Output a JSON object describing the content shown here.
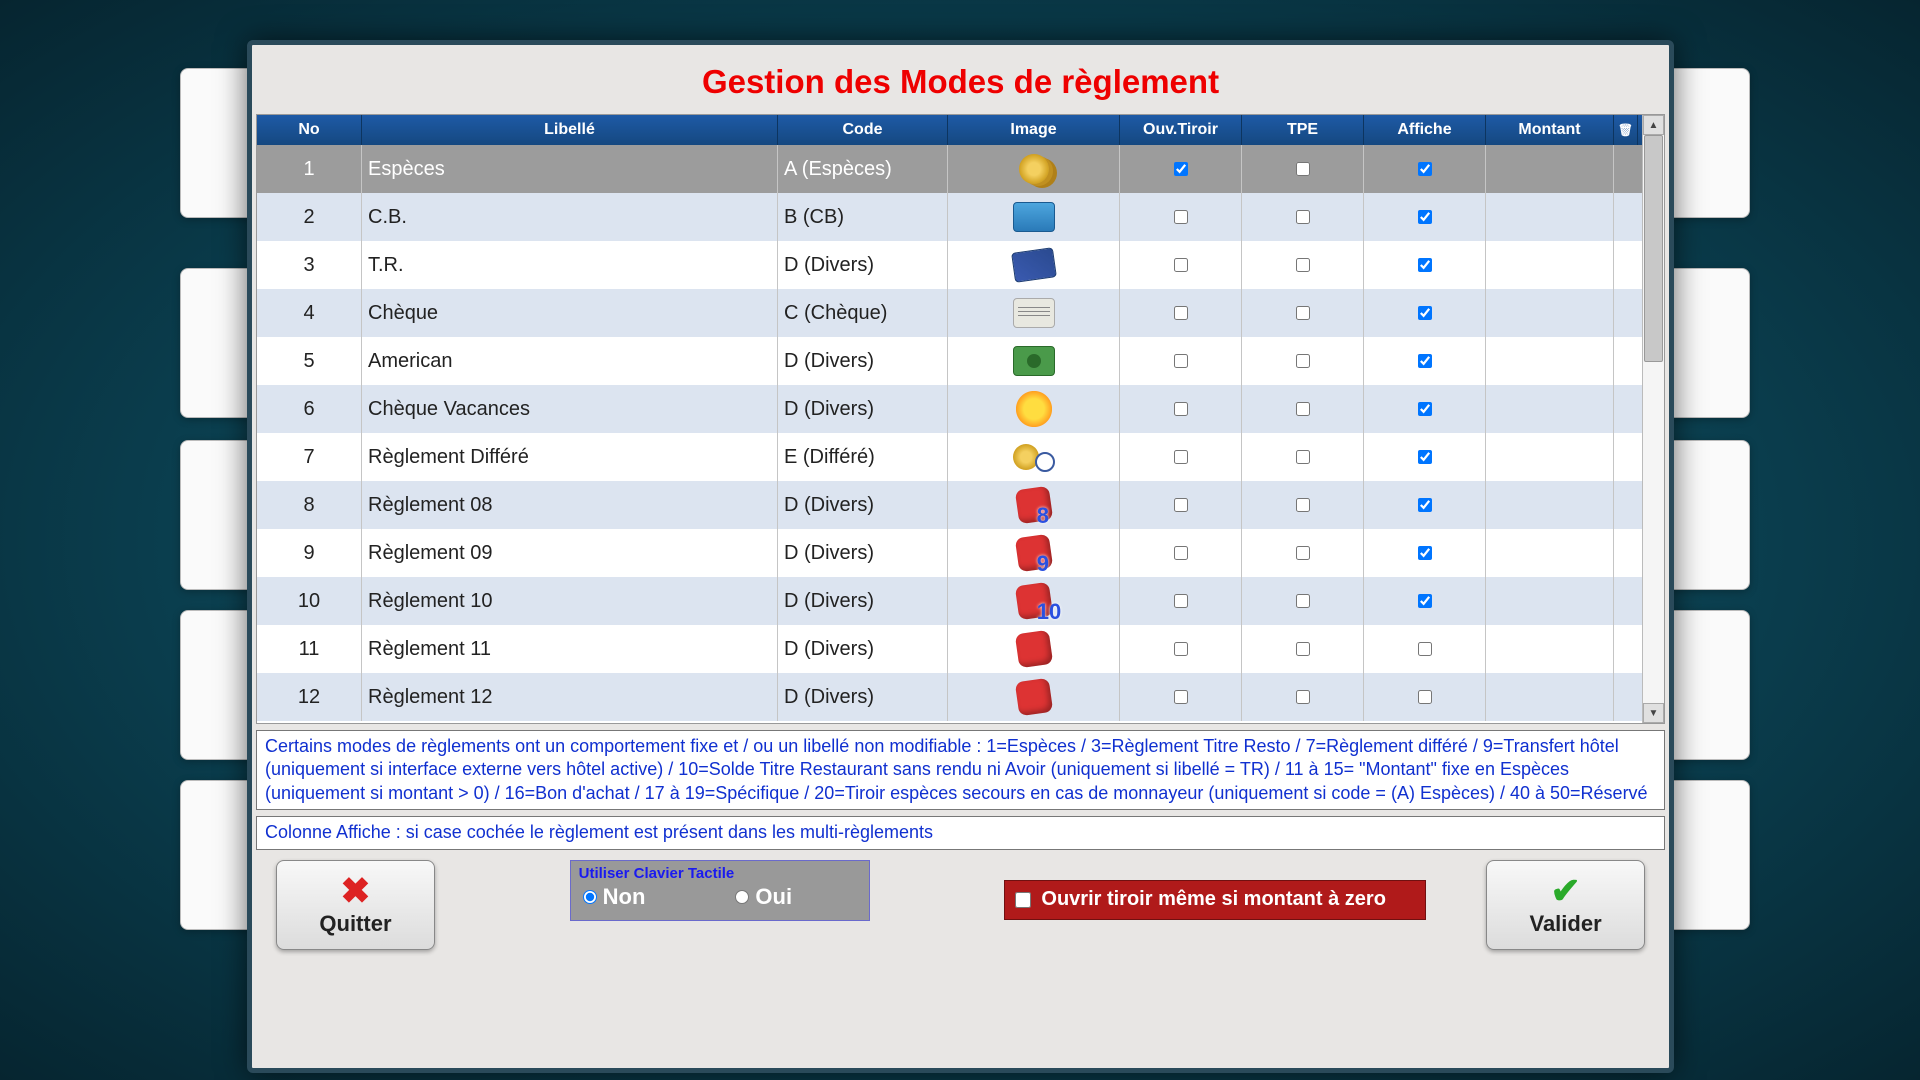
{
  "title": "Gestion des Modes de règlement",
  "columns": {
    "no": "No",
    "label": "Libellé",
    "code": "Code",
    "image": "Image",
    "ouv": "Ouv.Tiroir",
    "tpe": "TPE",
    "aff": "Affiche",
    "montant": "Montant"
  },
  "rows": [
    {
      "no": "1",
      "label": "Espèces",
      "code": "A (Espèces)",
      "icon": "coins",
      "overlay": "",
      "ouv": true,
      "tpe": false,
      "aff": true,
      "montant": "",
      "selected": true
    },
    {
      "no": "2",
      "label": "C.B.",
      "code": "B (CB)",
      "icon": "card",
      "overlay": "",
      "ouv": false,
      "tpe": false,
      "aff": true,
      "montant": ""
    },
    {
      "no": "3",
      "label": "T.R.",
      "code": "D (Divers)",
      "icon": "ticket",
      "overlay": "",
      "ouv": false,
      "tpe": false,
      "aff": true,
      "montant": ""
    },
    {
      "no": "4",
      "label": "Chèque",
      "code": "C (Chèque)",
      "icon": "cheque",
      "overlay": "",
      "ouv": false,
      "tpe": false,
      "aff": true,
      "montant": ""
    },
    {
      "no": "5",
      "label": "American",
      "code": "D (Divers)",
      "icon": "bill",
      "overlay": "",
      "ouv": false,
      "tpe": false,
      "aff": true,
      "montant": ""
    },
    {
      "no": "6",
      "label": "Chèque Vacances",
      "code": "D (Divers)",
      "icon": "sun",
      "overlay": "",
      "ouv": false,
      "tpe": false,
      "aff": true,
      "montant": ""
    },
    {
      "no": "7",
      "label": "Règlement Différé",
      "code": "E (Différé)",
      "icon": "deferred",
      "overlay": "",
      "ouv": false,
      "tpe": false,
      "aff": true,
      "montant": ""
    },
    {
      "no": "8",
      "label": "Règlement 08",
      "code": "D (Divers)",
      "icon": "dice",
      "overlay": "8",
      "ouv": false,
      "tpe": false,
      "aff": true,
      "montant": ""
    },
    {
      "no": "9",
      "label": "Règlement 09",
      "code": "D (Divers)",
      "icon": "dice",
      "overlay": "9",
      "ouv": false,
      "tpe": false,
      "aff": true,
      "montant": ""
    },
    {
      "no": "10",
      "label": "Règlement 10",
      "code": "D (Divers)",
      "icon": "dice",
      "overlay": "10",
      "ouv": false,
      "tpe": false,
      "aff": true,
      "montant": ""
    },
    {
      "no": "11",
      "label": "Règlement 11",
      "code": "D (Divers)",
      "icon": "dice",
      "overlay": "",
      "ouv": false,
      "tpe": false,
      "aff": false,
      "montant": ""
    },
    {
      "no": "12",
      "label": "Règlement 12",
      "code": "D (Divers)",
      "icon": "dice",
      "overlay": "",
      "ouv": false,
      "tpe": false,
      "aff": false,
      "montant": ""
    }
  ],
  "info1": "Certains modes de règlements ont un comportement fixe et / ou un libellé non modifiable :\n1=Espèces  /  3=Règlement Titre Resto  /  7=Règlement différé  /  9=Transfert hôtel (uniquement si interface externe vers hôtel active)  /  10=Solde Titre Restaurant sans rendu ni Avoir (uniquement si libellé = TR)  /  11 à 15= \"Montant\" fixe en Espèces (uniquement si montant > 0)  /  16=Bon d'achat  /  17 à 19=Spécifique  /  20=Tiroir espèces secours en cas de monnayeur (uniquement si code = (A) Espèces)  /  40 à 50=Réservé",
  "info2": "Colonne Affiche : si case cochée le règlement est présent dans les multi-règlements",
  "keyboard": {
    "legend": "Utiliser Clavier Tactile",
    "no": "Non",
    "yes": "Oui",
    "selected": "no"
  },
  "open_drawer": {
    "label": "Ouvrir tiroir même si montant à zero",
    "checked": false
  },
  "buttons": {
    "quit": "Quitter",
    "validate": "Valider"
  },
  "colors": {
    "title": "#ee0000",
    "header_bg": "#154880",
    "link": "#1030d0",
    "danger": "#b01a1a"
  }
}
